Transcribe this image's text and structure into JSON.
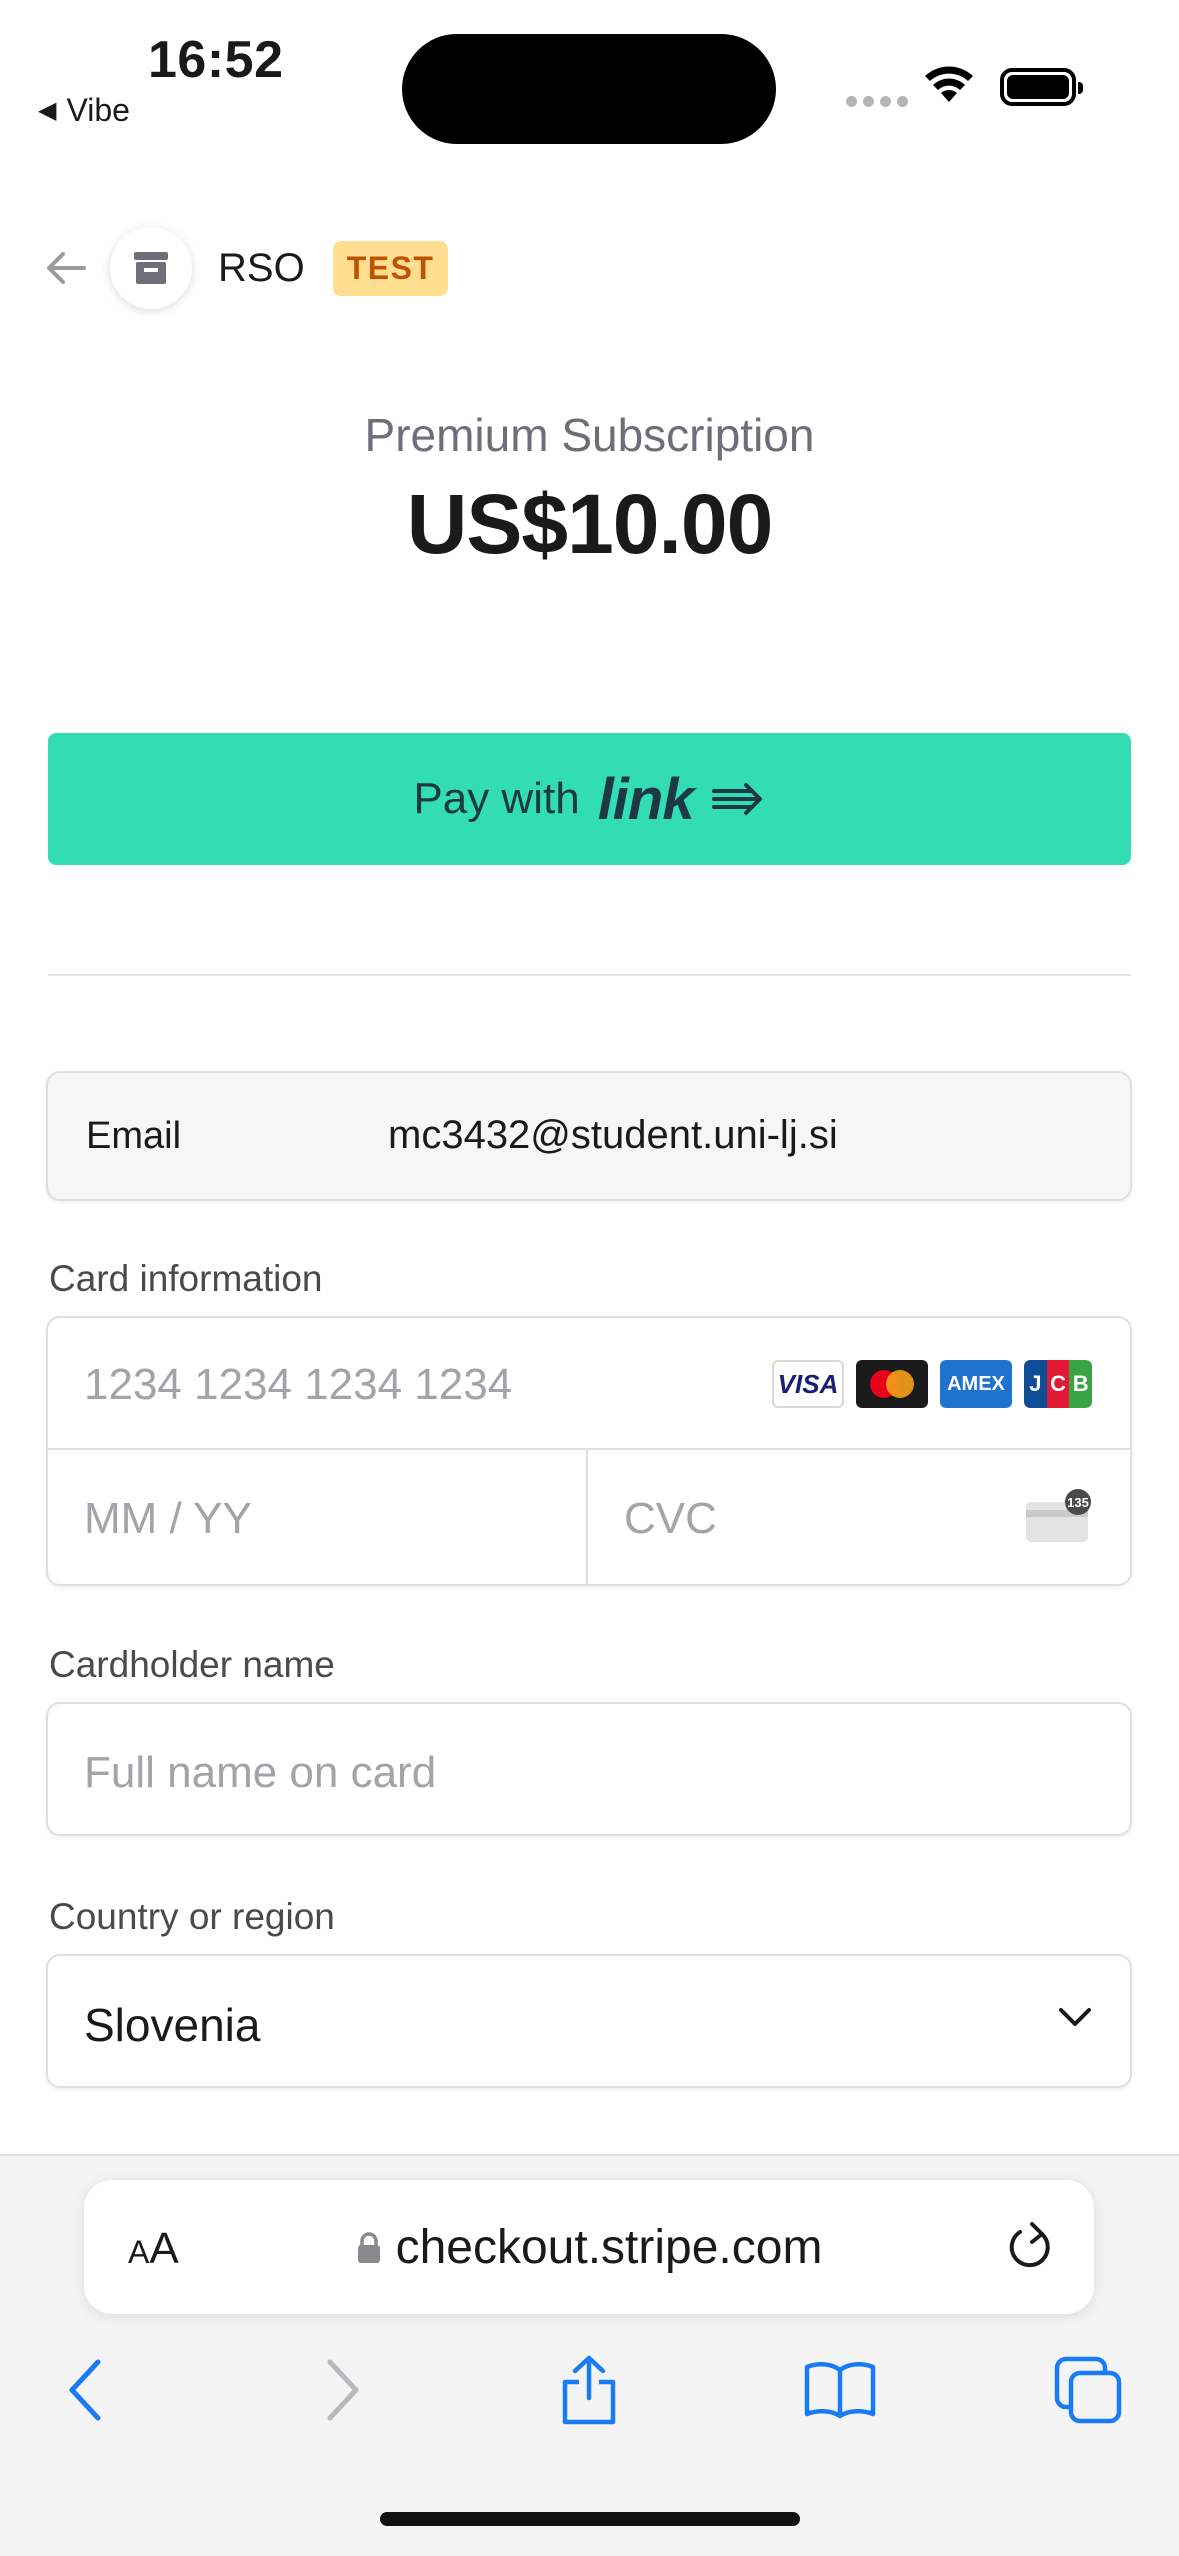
{
  "status_bar": {
    "time": "16:52",
    "back_app": "Vibe",
    "icons": [
      "signal-icon",
      "wifi-icon",
      "battery-icon"
    ]
  },
  "merchant": {
    "name": "RSO",
    "badge": "TEST",
    "icons": [
      "back-arrow-icon",
      "store-icon"
    ]
  },
  "product": {
    "name": "Premium Subscription",
    "price": "US$10.00"
  },
  "link_button": {
    "prefix": "Pay with",
    "brand": "link",
    "icon": "arrow-right-icon",
    "color": "#33ddb3"
  },
  "email": {
    "label": "Email",
    "value": "mc3432@student.uni-lj.si"
  },
  "card": {
    "label": "Card information",
    "number_placeholder": "1234 1234 1234 1234",
    "expiry_placeholder": "MM / YY",
    "cvc_placeholder": "CVC",
    "cvc_icon_text": "135",
    "brands": [
      "VISA",
      "mastercard",
      "AMEX",
      "JCB"
    ]
  },
  "cardholder": {
    "label": "Cardholder name",
    "placeholder": "Full name on card"
  },
  "country": {
    "label": "Country or region",
    "value": "Slovenia"
  },
  "safari": {
    "aa_label_small": "A",
    "aa_label_large": "A",
    "url": "checkout.stripe.com",
    "toolbar": [
      "back-icon",
      "forward-icon",
      "share-icon",
      "bookmarks-icon",
      "tabs-icon"
    ]
  },
  "colors": {
    "accent": "#33ddb3",
    "badge_bg": "#ffde92",
    "badge_text": "#bb5504",
    "safari_blue": "#1a7cf5"
  }
}
